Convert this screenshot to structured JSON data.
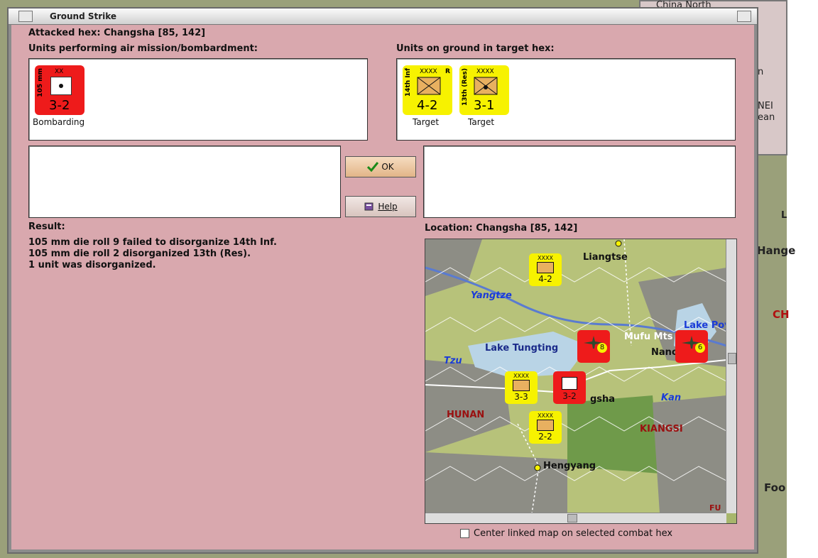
{
  "background": {
    "panel_lines": [
      "China North",
      "n",
      "NEI",
      "ean"
    ],
    "map_labels": [
      "Hange",
      "CH",
      "Foo",
      "L"
    ]
  },
  "dialog": {
    "title": "Ground Strike",
    "attacked_hex": "Attacked hex: Changsha  [85, 142]",
    "air_label": "Units performing air mission/bombardment:",
    "ground_label": "Units on ground in target hex:",
    "air_units": [
      {
        "side": "105 mm",
        "size": "XX",
        "strength": "3-2",
        "caption": "Bombarding",
        "color": "#ee1b1b"
      }
    ],
    "ground_units": [
      {
        "side": "14th Inf",
        "size": "XXXX",
        "flag": "R",
        "strength": "4-2",
        "caption": "Target",
        "color": "#f7f200"
      },
      {
        "side": "13th (Res)",
        "size": "XXXX",
        "flag": "",
        "strength": "3-1",
        "caption": "Target",
        "color": "#f7f200"
      }
    ],
    "ok_label": "OK",
    "help_label": "Help",
    "result_label": "Result:",
    "result_lines": [
      "105 mm die roll 9 failed to disorganize 14th Inf.",
      "105 mm die roll 2 disorganized 13th (Res).",
      "1 unit was disorganized."
    ],
    "location_label": "Location:  Changsha  [85, 142]",
    "checkbox_label": "Center linked map on selected combat hex"
  },
  "map": {
    "places": [
      {
        "name": "Liangtse",
        "color": "#111111"
      },
      {
        "name": "Yangtze",
        "color": "#1a3bd8"
      },
      {
        "name": "Mufu Mts",
        "color": "#ffffff"
      },
      {
        "name": "Lake Poy",
        "color": "#1a3bd8"
      },
      {
        "name": "Lake Tungting",
        "color": "#1a2a8a"
      },
      {
        "name": "Nanc",
        "color": "#111111"
      },
      {
        "name": "Tzu",
        "color": "#1a3bd8"
      },
      {
        "name": "gsha",
        "color": "#111111"
      },
      {
        "name": "Kan",
        "color": "#1a3bd8"
      },
      {
        "name": "HUNAN",
        "color": "#9a1010"
      },
      {
        "name": "KIANGSI",
        "color": "#9a1010"
      },
      {
        "name": "Hengyang",
        "color": "#111111"
      },
      {
        "name": "FU",
        "color": "#9a1010"
      }
    ],
    "counters": [
      {
        "strength": "4-2",
        "size": "XXXX",
        "color": "#f7f200"
      },
      {
        "strength": "8",
        "size": "",
        "color": "#ee1b1b"
      },
      {
        "strength": "6",
        "size": "",
        "color": "#ee1b1b"
      },
      {
        "strength": "3-3",
        "size": "XXXX",
        "color": "#f7f200"
      },
      {
        "strength": "3-2",
        "size": "",
        "color": "#ee1b1b"
      },
      {
        "strength": "2-2",
        "size": "XXXX",
        "color": "#f7f200"
      }
    ]
  }
}
